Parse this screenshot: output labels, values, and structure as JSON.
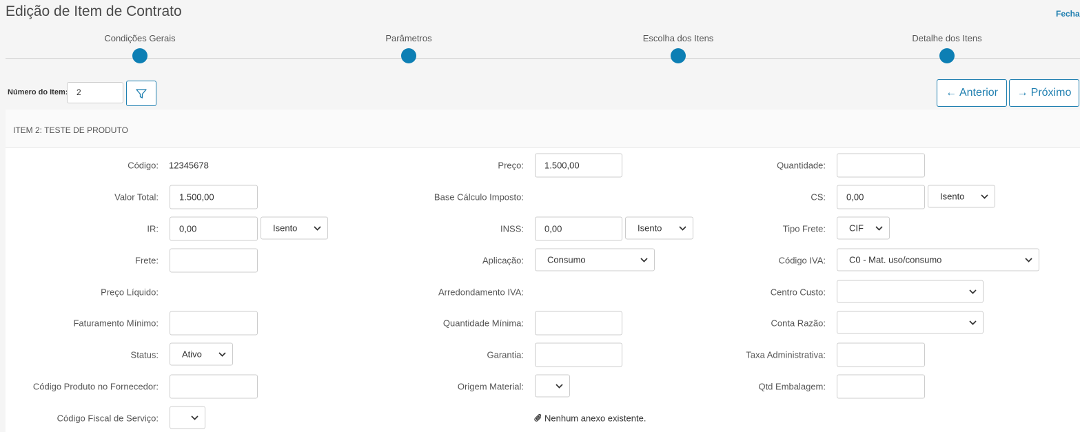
{
  "page": {
    "title": "Edição de Item de Contrato",
    "close_label": "Fechar"
  },
  "steps": [
    {
      "label": "Condições Gerais"
    },
    {
      "label": "Parâmetros"
    },
    {
      "label": "Escolha dos Itens"
    },
    {
      "label": "Detalhe dos Itens"
    }
  ],
  "toolbar": {
    "item_number_label": "Número do Item:",
    "item_number_value": "2",
    "prev_label": "Anterior",
    "next_label": "Próximo"
  },
  "colors": {
    "accent": "#0d7fb4",
    "link": "#1f7fb0"
  },
  "item": {
    "header": "ITEM 2: TESTE DE PRODUTO",
    "fields": {
      "codigo": {
        "label": "Código:",
        "value": "12345678"
      },
      "preco": {
        "label": "Preço:",
        "value": "1.500,00"
      },
      "quantidade": {
        "label": "Quantidade:",
        "value": ""
      },
      "valor_total": {
        "label": "Valor Total:",
        "value": "1.500,00"
      },
      "base_calculo": {
        "label": "Base Cálculo Imposto:",
        "value": ""
      },
      "cs": {
        "label": "CS:",
        "value": "0,00",
        "option": "Isento"
      },
      "ir": {
        "label": "IR:",
        "value": "0,00",
        "option": "Isento"
      },
      "inss": {
        "label": "INSS:",
        "value": "0,00",
        "option": "Isento"
      },
      "tipo_frete": {
        "label": "Tipo Frete:",
        "option": "CIF"
      },
      "frete": {
        "label": "Frete:",
        "value": ""
      },
      "aplicacao": {
        "label": "Aplicação:",
        "option": "Consumo"
      },
      "codigo_iva": {
        "label": "Código IVA:",
        "option": "C0 - Mat. uso/consumo"
      },
      "preco_liquido": {
        "label": "Preço Líquido:",
        "value": ""
      },
      "arredondamento_iva": {
        "label": "Arredondamento IVA:",
        "value": ""
      },
      "centro_custo": {
        "label": "Centro Custo:",
        "option": ""
      },
      "faturamento_minimo": {
        "label": "Faturamento Mínimo:",
        "value": ""
      },
      "quantidade_minima": {
        "label": "Quantidade Mínima:",
        "value": ""
      },
      "conta_razao": {
        "label": "Conta Razão:",
        "option": ""
      },
      "status": {
        "label": "Status:",
        "option": "Ativo"
      },
      "garantia": {
        "label": "Garantia:",
        "value": ""
      },
      "taxa_administrativa": {
        "label": "Taxa Administrativa:",
        "value": ""
      },
      "codigo_produto_fornecedor": {
        "label": "Código Produto no Fornecedor:",
        "value": ""
      },
      "origem_material": {
        "label": "Origem Material:",
        "option": ""
      },
      "qtd_embalagem": {
        "label": "Qtd Embalagem:",
        "value": ""
      },
      "codigo_fiscal_servico": {
        "label": "Código Fiscal de Serviço:",
        "option": ""
      }
    },
    "attachment_text": "Nenhum anexo existente."
  }
}
